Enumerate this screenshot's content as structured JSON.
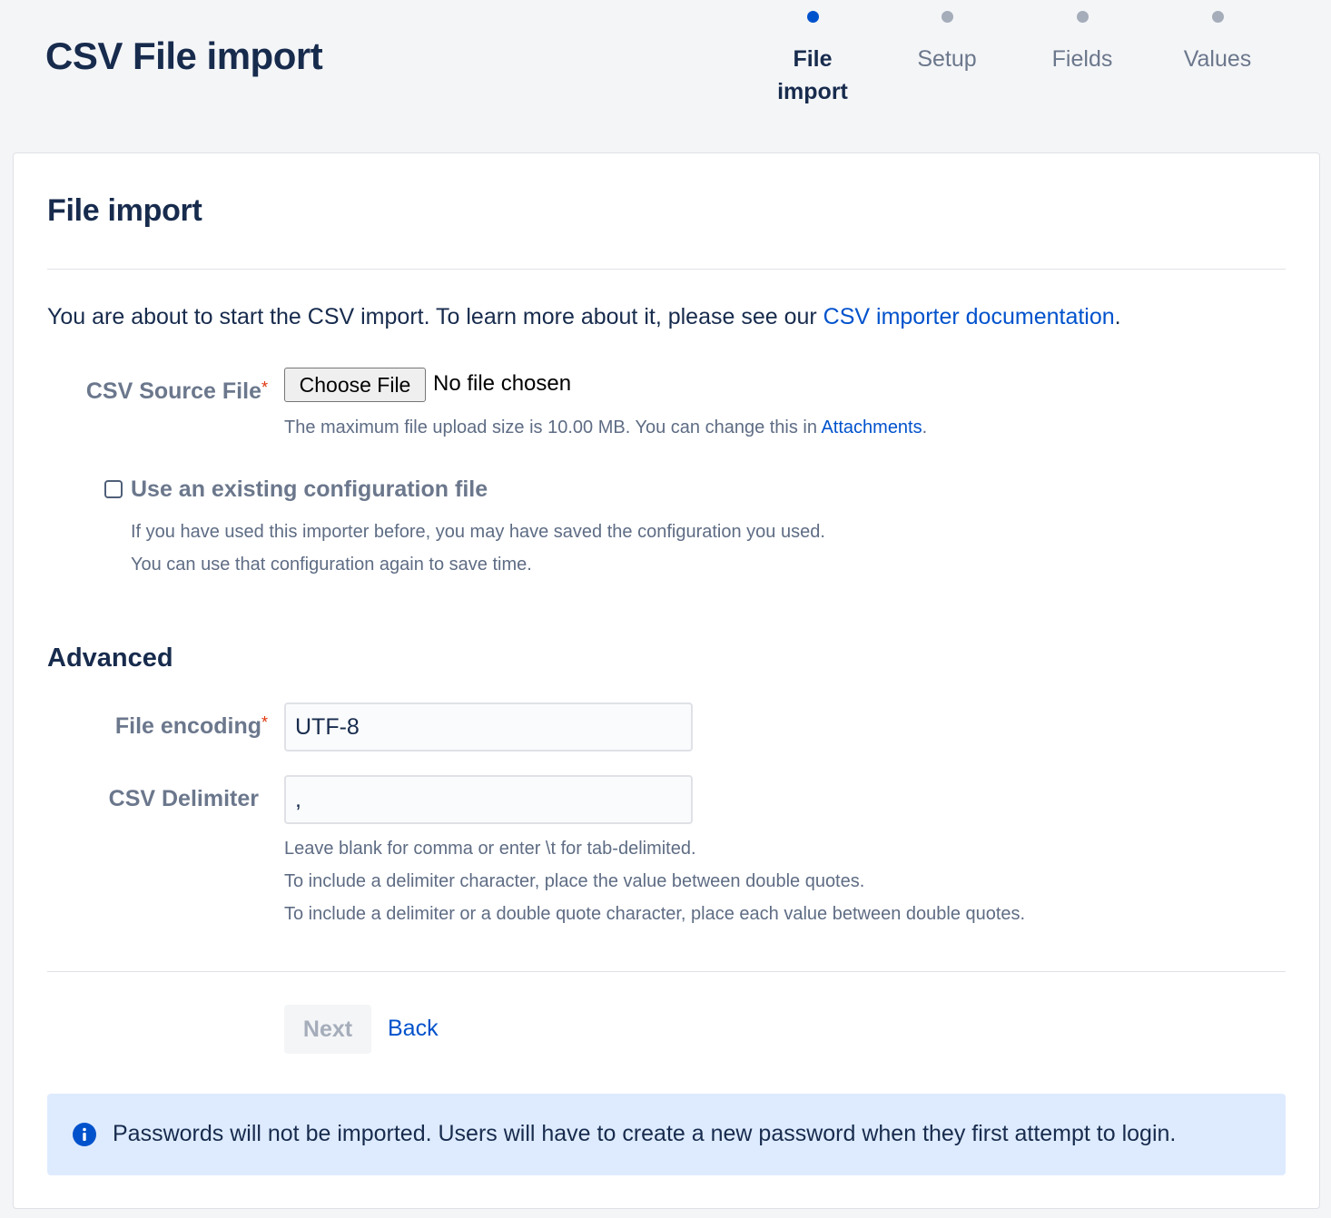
{
  "page": {
    "title": "CSV File import"
  },
  "stepper": {
    "steps": [
      {
        "label": "File import",
        "active": true
      },
      {
        "label": "Setup",
        "active": false
      },
      {
        "label": "Fields",
        "active": false
      },
      {
        "label": "Values",
        "active": false
      }
    ]
  },
  "panel": {
    "title": "File import",
    "intro_text": "You are about to start the CSV import. To learn more about it, please see our ",
    "intro_link": "CSV importer documentation",
    "intro_end": "."
  },
  "source_file": {
    "label": "CSV Source File",
    "required_mark": "*",
    "button_label": "Choose File",
    "status": "No file chosen",
    "help_text": "The maximum file upload size is 10.00 MB. You can change this in ",
    "help_link": "Attachments",
    "help_end": "."
  },
  "config_file": {
    "label": "Use an existing configuration file",
    "checked": false,
    "help_line1": "If you have used this importer before, you may have saved the configuration you used.",
    "help_line2": "You can use that configuration again to save time."
  },
  "advanced": {
    "title": "Advanced",
    "encoding_label": "File encoding",
    "encoding_required_mark": "*",
    "encoding_value": "UTF-8",
    "delimiter_label": "CSV Delimiter",
    "delimiter_value": ",",
    "delimiter_help1": "Leave blank for comma or enter \\t for tab-delimited.",
    "delimiter_help2": "To include a delimiter character, place the value between double quotes.",
    "delimiter_help3": "To include a delimiter or a double quote character, place each value between double quotes."
  },
  "actions": {
    "next_label": "Next",
    "back_label": "Back"
  },
  "info": {
    "icon": "info-icon",
    "text": "Passwords will not be imported. Users will have to create a new password when they first attempt to login."
  },
  "colors": {
    "primary": "#0052cc",
    "text": "#172b4d",
    "muted": "#6b778c",
    "required": "#de350b",
    "info_bg": "#deebff"
  }
}
